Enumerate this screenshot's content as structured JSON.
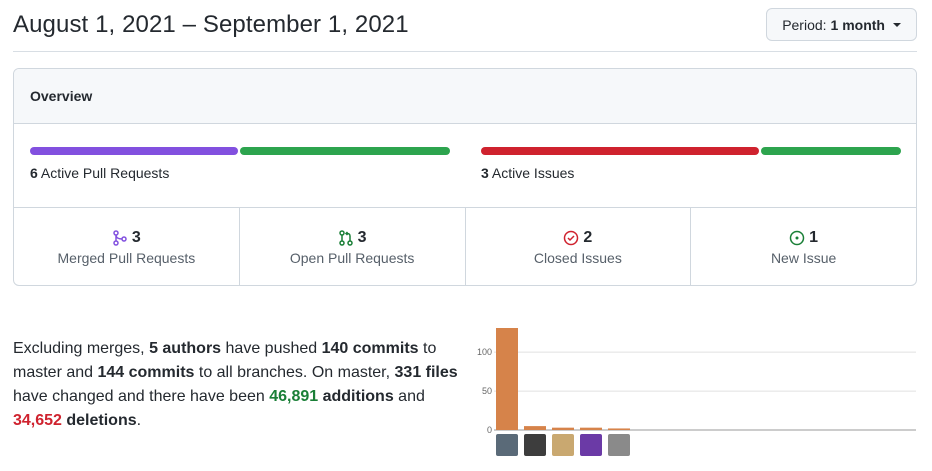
{
  "header": {
    "date_range": "August 1, 2021 – September 1, 2021",
    "period_label": "Period:",
    "period_value": "1 month"
  },
  "overview": {
    "title": "Overview",
    "pull_requests": {
      "count": "6",
      "label": "Active Pull Requests",
      "merged_color": "#8250df",
      "open_color": "#2da44e"
    },
    "issues": {
      "count": "3",
      "label": "Active Issues",
      "closed_color": "#cf222e",
      "new_color": "#2da44e"
    },
    "stats": [
      {
        "count": "3",
        "label": "Merged Pull Requests",
        "icon": "git-merge-icon",
        "color": "#8250df"
      },
      {
        "count": "3",
        "label": "Open Pull Requests",
        "icon": "git-pull-request-icon",
        "color": "#1a7f37"
      },
      {
        "count": "2",
        "label": "Closed Issues",
        "icon": "issue-closed-icon",
        "color": "#cf222e"
      },
      {
        "count": "1",
        "label": "New Issue",
        "icon": "issue-opened-icon",
        "color": "#1a7f37"
      }
    ]
  },
  "summary": {
    "t1": "Excluding merges, ",
    "authors": "5 authors",
    "t2": " have pushed ",
    "commits_master": "140 commits",
    "t3": " to master and ",
    "commits_all": "144 commits",
    "t4": " to all branches. On master, ",
    "files": "331 files",
    "t5": " have changed and there have been ",
    "additions_num": "46,891",
    "additions_word": " additions",
    "t6": " and ",
    "deletions_num": "34,652",
    "deletions_word": " deletions",
    "t7": "."
  },
  "chart_data": {
    "type": "bar",
    "values": [
      131,
      5,
      3,
      3,
      2
    ],
    "ylim": [
      0,
      131
    ],
    "yticks": [
      0,
      50,
      100
    ],
    "bar_color": "#d6834a",
    "grid": true
  },
  "avatars": [
    {
      "name": "contributor-1",
      "color": "#5a6a78"
    },
    {
      "name": "contributor-2",
      "color": "#3d3d3d"
    },
    {
      "name": "contributor-3",
      "color": "#c9a870"
    },
    {
      "name": "contributor-4",
      "color": "#6b3aa6"
    },
    {
      "name": "contributor-5",
      "color": "#8a8a8a"
    }
  ]
}
